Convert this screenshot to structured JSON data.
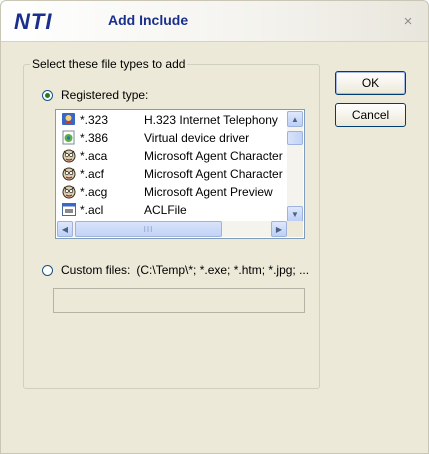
{
  "dialog": {
    "logo": "NTI",
    "title": "Add Include",
    "close_glyph": "×"
  },
  "group": {
    "legend": "Select these file types to add",
    "registered_label": "Registered type:",
    "registered_selected": true,
    "custom_label": "Custom files:",
    "custom_value": "(C:\\Temp\\*; *.exe; *.htm; *.jpg; ...",
    "custom_input_value": ""
  },
  "filetypes": [
    {
      "ext": "*.323",
      "desc": "H.323 Internet Telephony",
      "icon": "netmeeting-icon"
    },
    {
      "ext": "*.386",
      "desc": "Virtual device driver",
      "icon": "driver-icon"
    },
    {
      "ext": "*.aca",
      "desc": "Microsoft Agent Character",
      "icon": "agent-icon"
    },
    {
      "ext": "*.acf",
      "desc": "Microsoft Agent Character",
      "icon": "agent-icon"
    },
    {
      "ext": "*.acg",
      "desc": "Microsoft Agent Preview",
      "icon": "agent-icon"
    },
    {
      "ext": "*.acl",
      "desc": "ACLFile",
      "icon": "acl-file-icon"
    }
  ],
  "buttons": {
    "ok": "OK",
    "cancel": "Cancel"
  },
  "scroll_glyphs": {
    "up": "▲",
    "down": "▼",
    "left": "◀",
    "right": "▶",
    "grip": "III"
  }
}
